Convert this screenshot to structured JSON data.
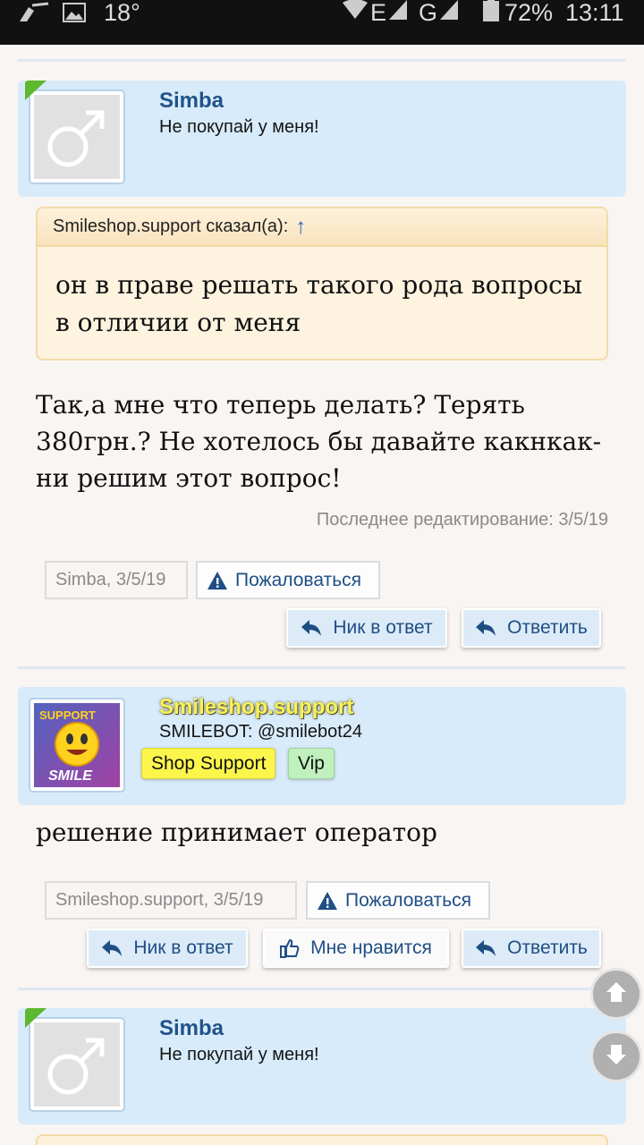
{
  "status_bar": {
    "temperature": "18°",
    "network_label": "E",
    "network_label_2": "G",
    "battery": "72%",
    "time": "13:11"
  },
  "post1": {
    "username": "Simba",
    "user_title": "Не покупай у меня!",
    "quote_header": "Smileshop.support сказал(а):",
    "quote_arrow": "↑",
    "quote_text": "он в праве решать такого рода вопросы в отличии от меня",
    "message": "Так,а мне что теперь делать? Терять 380грн.? Не хотелось бы давайте какнкак-ни решим этот вопрос!",
    "edited": "Последнее редактирование: 3/5/19",
    "meta_author": "Simba",
    "meta_date": ", 3/5/19",
    "report_label": "Пожаловаться",
    "reply_nick_label": "Ник в ответ",
    "reply_label": "Ответить"
  },
  "post2": {
    "username": "Smileshop.support",
    "user_title": "SMILEBOT: @smilebot24",
    "badges": [
      "Shop Support",
      "Vip"
    ],
    "avatar_text_top": "SUPPORT",
    "avatar_text_bottom": "SMILE shop",
    "message": "решение принимает оператор",
    "meta_author": "Smileshop.support",
    "meta_date": ", 3/5/19",
    "report_label": "Пожаловаться",
    "reply_nick_label": "Ник в ответ",
    "like_label": "Мне нравится",
    "reply_label": "Ответить"
  },
  "post3": {
    "username": "Simba",
    "user_title": "Не покупай у меня!"
  },
  "icons": {
    "scroll_up": "arrow-up-icon",
    "scroll_down": "arrow-down-icon",
    "report": "warning-icon",
    "reply": "reply-icon",
    "like": "thumbs-up-icon"
  },
  "colors": {
    "username": "#20538a",
    "header_bg": "#d8ebfa",
    "quote_bg": "#fdf3df",
    "badge_support": "#fbf54c",
    "badge_vip": "#bff0bd",
    "online": "#5cb82e"
  }
}
